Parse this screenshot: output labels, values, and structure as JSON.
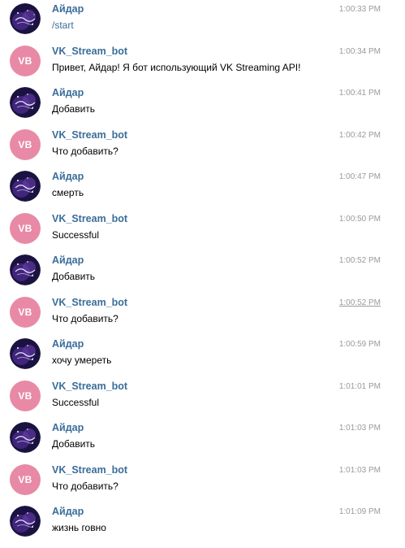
{
  "colors": {
    "sender_name": "#3a6d99",
    "bot_avatar_bg": "#e88aa6",
    "timestamp": "#9a9a9a",
    "message_text": "#000000",
    "user_avatar_bg": "#1a1240"
  },
  "user": {
    "name": "Айдар",
    "avatar_icon": "space-nebula-avatar"
  },
  "bot": {
    "name": "VK_Stream_bot",
    "initials": "VB"
  },
  "messages": [
    {
      "from": "user",
      "sender": "Айдар",
      "text": "/start",
      "time": "1:00:33 PM"
    },
    {
      "from": "bot",
      "sender": "VK_Stream_bot",
      "text": "Привет, Айдар! Я бот использующий VK Streaming API!",
      "time": "1:00:34 PM"
    },
    {
      "from": "user",
      "sender": "Айдар",
      "text": "Добавить",
      "time": "1:00:41 PM"
    },
    {
      "from": "bot",
      "sender": "VK_Stream_bot",
      "text": "Что добавить?",
      "time": "1:00:42 PM"
    },
    {
      "from": "user",
      "sender": "Айдар",
      "text": "смерть",
      "time": "1:00:47 PM"
    },
    {
      "from": "bot",
      "sender": "VK_Stream_bot",
      "text": "Successful",
      "time": "1:00:50 PM"
    },
    {
      "from": "user",
      "sender": "Айдар",
      "text": "Добавить",
      "time": "1:00:52 PM"
    },
    {
      "from": "bot",
      "sender": "VK_Stream_bot",
      "text": "Что добавить?",
      "time": "1:00:52 PM"
    },
    {
      "from": "user",
      "sender": "Айдар",
      "text": "хочу умереть",
      "time": "1:00:59 PM"
    },
    {
      "from": "bot",
      "sender": "VK_Stream_bot",
      "text": "Successful",
      "time": "1:01:01 PM"
    },
    {
      "from": "user",
      "sender": "Айдар",
      "text": "Добавить",
      "time": "1:01:03 PM"
    },
    {
      "from": "bot",
      "sender": "VK_Stream_bot",
      "text": "Что добавить?",
      "time": "1:01:03 PM"
    },
    {
      "from": "user",
      "sender": "Айдар",
      "text": "жизнь говно",
      "time": "1:01:09 PM"
    }
  ]
}
